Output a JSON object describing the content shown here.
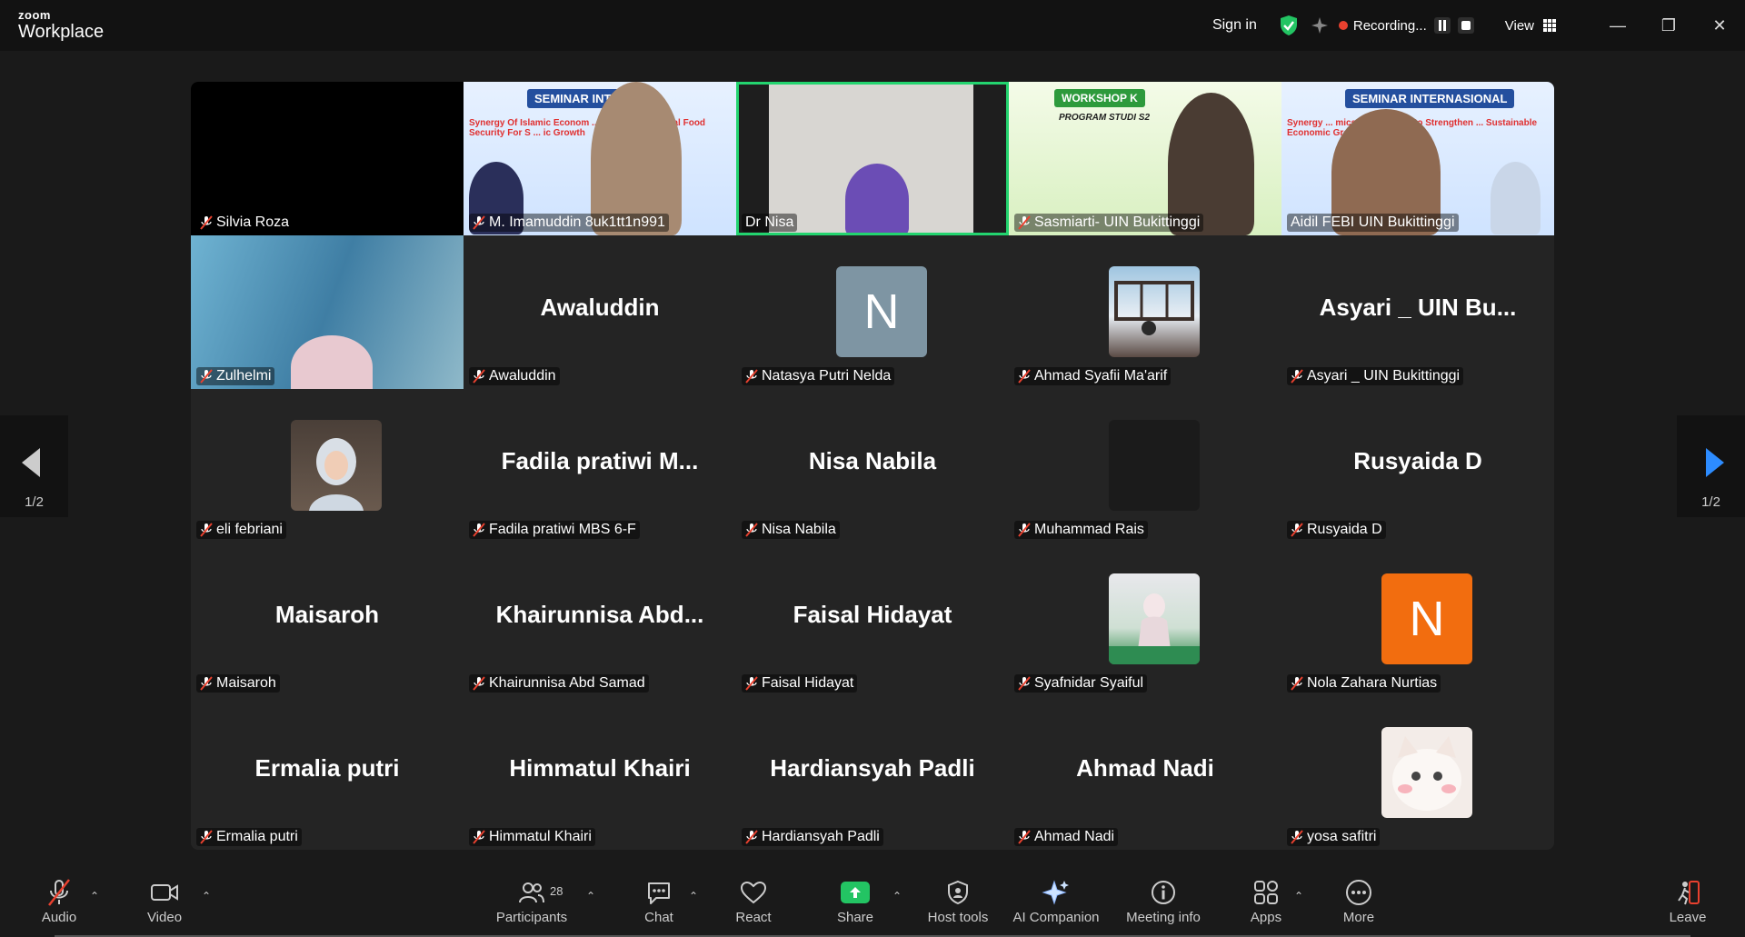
{
  "window": {
    "logo_small": "zoom",
    "logo_main": "Workplace",
    "sign_in": "Sign in",
    "recording_label": "Recording...",
    "view_label": "View"
  },
  "gallery": {
    "page_indicator_left": "1/2",
    "page_indicator_right": "1/2",
    "tiles": [
      {
        "label": "Silvia Roza"
      },
      {
        "label": "M. Imamuddin 8uk1tt1n991",
        "poster": "SEMINAR INT",
        "poster_sub": "Synergy Of Islamic Econom ... Strengthen Global Food Security For S ... ic Growth"
      },
      {
        "label": "Dr Nisa"
      },
      {
        "label": "Sasmiarti- UIN Bukittinggi",
        "poster": "WORKSHOP K",
        "poster_sub": "PROGRAM STUDI S2"
      },
      {
        "label": "Aidil FEBI UIN Bukittinggi",
        "poster": "SEMINAR INTERNASIONAL",
        "poster_sub": "Synergy ... mics and Finance to Strengthen ... Sustainable Economic Growth"
      },
      {
        "label": "Zulhelmi"
      },
      {
        "label": "Awaluddin",
        "big": "Awaluddin"
      },
      {
        "label": "Natasya Putri Nelda",
        "initial": "N"
      },
      {
        "label": "Ahmad Syafii Ma'arif"
      },
      {
        "label": "Asyari _ UIN Bukittinggi",
        "big": "Asyari _ UIN Bu..."
      },
      {
        "label": "eli febriani"
      },
      {
        "label": "Fadila pratiwi MBS 6-F",
        "big": "Fadila pratiwi M..."
      },
      {
        "label": "Nisa Nabila",
        "big": "Nisa Nabila"
      },
      {
        "label": "Muhammad Rais"
      },
      {
        "label": "Rusyaida D",
        "big": "Rusyaida D"
      },
      {
        "label": "Maisaroh",
        "big": "Maisaroh"
      },
      {
        "label": "Khairunnisa Abd Samad",
        "big": "Khairunnisa  Abd..."
      },
      {
        "label": "Faisal Hidayat",
        "big": "Faisal Hidayat"
      },
      {
        "label": "Syafnidar Syaiful"
      },
      {
        "label": "Nola Zahara Nurtias",
        "initial": "N"
      },
      {
        "label": "Ermalia putri",
        "big": "Ermalia putri"
      },
      {
        "label": "Himmatul Khairi",
        "big": "Himmatul Khairi"
      },
      {
        "label": "Hardiansyah Padli",
        "big": "Hardiansyah Padli"
      },
      {
        "label": "Ahmad Nadi",
        "big": "Ahmad Nadi"
      },
      {
        "label": "yosa safitri"
      }
    ]
  },
  "toolbar": {
    "audio": "Audio",
    "video": "Video",
    "participants": "Participants",
    "participants_count": "28",
    "chat": "Chat",
    "react": "React",
    "share": "Share",
    "host_tools": "Host tools",
    "ai_companion": "AI Companion",
    "meeting_info": "Meeting info",
    "apps": "Apps",
    "more": "More",
    "leave": "Leave"
  },
  "colors": {
    "active_speaker": "#23d46f",
    "share_green": "#23c463",
    "avatar_gray": "#7e95a3",
    "avatar_orange": "#f26d0f",
    "recording_red": "#e8412f"
  }
}
